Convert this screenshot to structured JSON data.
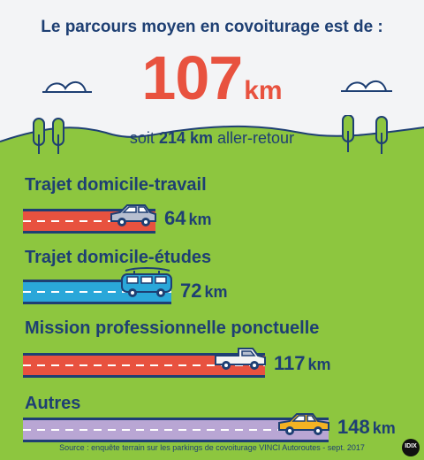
{
  "header": {
    "headline": "Le parcours moyen en covoiturage est de :",
    "average": {
      "value": "107",
      "unit": "km"
    },
    "roundtrip": {
      "prefix": "soit",
      "value": "214 km",
      "suffix": "aller-retour"
    }
  },
  "colors": {
    "navy": "#1e3f73",
    "grass": "#8dc63f",
    "accent_red": "#e8523f",
    "road_red": "#e8523f",
    "road_blue": "#2aa7d9",
    "road_grey": "#b9a6d4",
    "car_grey": "#b7bfd0",
    "car_blue": "#2aa7d9",
    "car_white": "#f4f4f4",
    "car_yellow": "#f4b223"
  },
  "categories": [
    {
      "label": "Trajet domicile-travail",
      "value": "64",
      "unit": "km",
      "share": 0.4324,
      "road_color": "red",
      "vehicle": "hatchback-car-icon"
    },
    {
      "label": "Trajet domicile-études",
      "value": "72",
      "unit": "km",
      "share": 0.4865,
      "road_color": "blue",
      "vehicle": "van-with-surfboard-icon"
    },
    {
      "label": "Mission professionnelle ponctuelle",
      "value": "117",
      "unit": "km",
      "share": 0.7905,
      "road_color": "red",
      "vehicle": "pickup-truck-icon"
    },
    {
      "label": "Autres",
      "value": "148",
      "unit": "km",
      "share": 1.0,
      "road_color": "grey",
      "vehicle": "yellow-car-icon"
    }
  ],
  "source": "Source : enquête terrain sur les parkings de covoiturage VINCI Autoroutes - sept. 2017",
  "logo_text": "IDIX"
}
